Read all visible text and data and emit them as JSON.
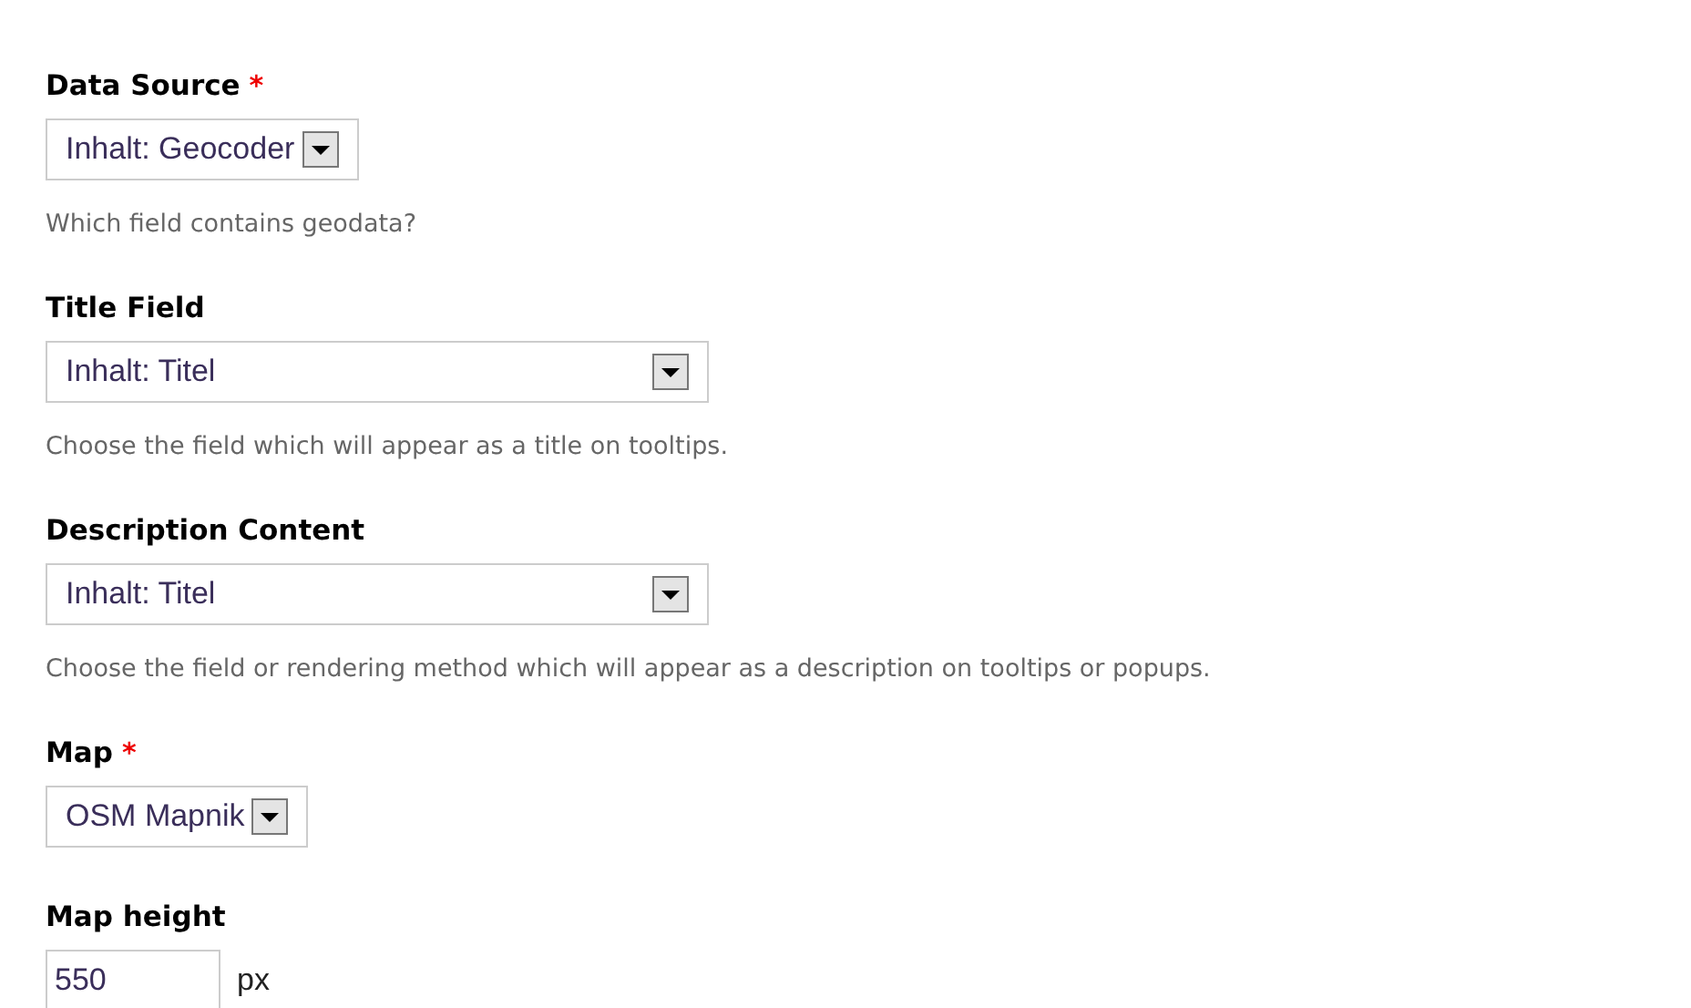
{
  "fields": [
    {
      "kind": "select",
      "label": "Data Source",
      "required_marker": "*",
      "value": "Inhalt: Geocoder",
      "description": "Which field contains geodata?"
    },
    {
      "kind": "select",
      "label": "Title Field",
      "value": "Inhalt: Titel",
      "description": "Choose the field which will appear as a title on tooltips."
    },
    {
      "kind": "select",
      "label": "Description Content",
      "value": "Inhalt: Titel",
      "description": "Choose the field or rendering method which will appear as a description on tooltips or popups."
    },
    {
      "kind": "select",
      "label": "Map",
      "required_marker": "*",
      "value": "OSM Mapnik"
    },
    {
      "kind": "number",
      "label": "Map height",
      "value": "550",
      "suffix": "px"
    }
  ]
}
